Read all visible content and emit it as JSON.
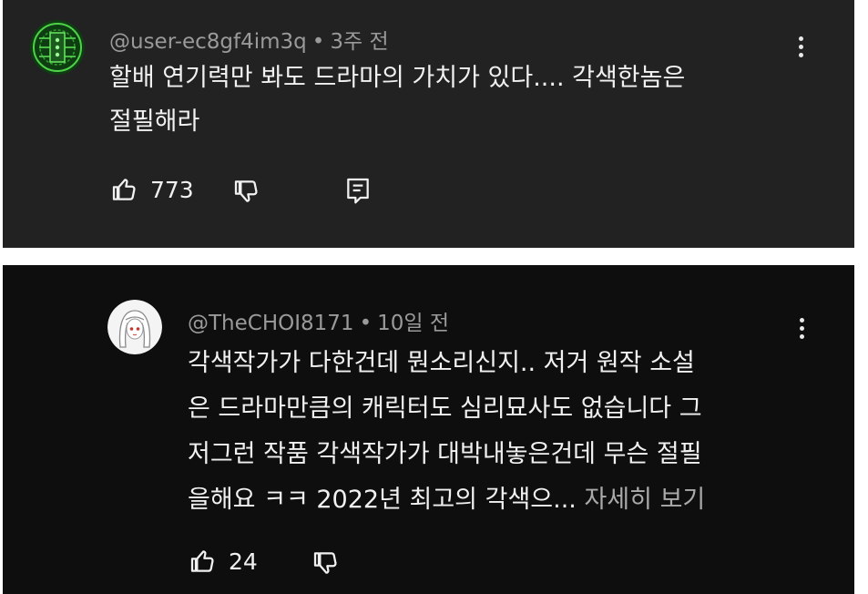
{
  "comment": {
    "author": "@user-ec8gf4im3q",
    "time": "3주 전",
    "text_line1": "할배 연기력만 봐도 드라마의 가치가 있다.... 각색한놈은",
    "text_line2": "절필해라",
    "like_count": "773",
    "avatar_icon": "green-circuit-avatar-icon"
  },
  "reply": {
    "author": "@TheCHOI8171",
    "time": "10일 전",
    "text_line1": "각색작가가 다한건데 뭔소리신지.. 저거 원작 소설",
    "text_line2": "은 드라마만큼의 캐릭터도 심리묘사도 없습니다 그",
    "text_line3": "저그런 작품 각색작가가 대박내놓은건데 무슨 절필",
    "text_line4": "을해요 ㅋㅋ 2022년 최고의 각색으...",
    "read_more": "자세히 보기",
    "like_count": "24",
    "avatar_icon": "anime-girl-avatar-icon"
  },
  "separator": "•",
  "colors": {
    "card1_bg": "#222222",
    "card2_bg": "#0e0e0e",
    "text": "#f1f1f1",
    "meta": "#9a9a9a"
  }
}
